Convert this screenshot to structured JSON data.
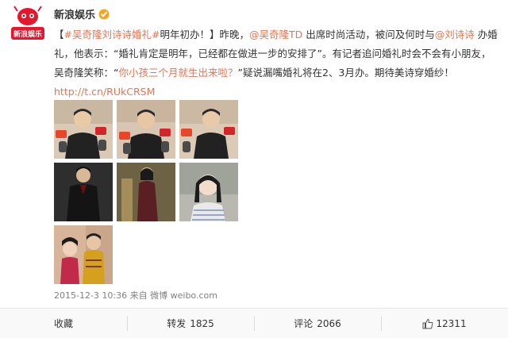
{
  "user": {
    "name": "新浪娱乐",
    "avatar_icon": "sina-entertainment-logo-icon",
    "avatar_text": "新浪娱乐",
    "verified": true
  },
  "post": {
    "bracket_open": "【",
    "topic": "#吴奇隆刘诗诗婚礼#",
    "headline": "明年初办！】",
    "text_1": "昨晚，",
    "mention_1": "@吴奇隆TD",
    "text_2": " 出席时尚活动，被问及何时与",
    "mention_2": "@刘诗诗",
    "text_3": " 办婚礼，他表示：“婚礼肯定是明年，已经都在做进一步的安排了”。有记者追问婚礼时会不会有小朋友，吴奇隆笑称：“",
    "quote": "你小孩三个月就生出来啦？",
    "text_4": "”疑说漏嘴婚礼将在2、3月办。期待美诗穿婚纱！",
    "short_link": "http://t.cn/RUkCRSM"
  },
  "images": [
    {
      "name": "photo-1",
      "desc": "Wu Qilong at press event"
    },
    {
      "name": "photo-2",
      "desc": "Wu Qilong at press event"
    },
    {
      "name": "photo-3",
      "desc": "Wu Qilong at press event"
    },
    {
      "name": "photo-4",
      "desc": "Wu Qilong in suit"
    },
    {
      "name": "photo-5",
      "desc": "Liu Shishi in dress"
    },
    {
      "name": "photo-6",
      "desc": "Liu Shishi portrait"
    },
    {
      "name": "photo-7",
      "desc": "Drama still"
    }
  ],
  "meta": {
    "timestamp": "2015-12-3 10:36",
    "from_label": "来自",
    "source": "微博 weibo.com"
  },
  "actions": {
    "favorite_label": "收藏",
    "repost_label": "转发",
    "repost_count": "1825",
    "comment_label": "评论",
    "comment_count": "2066",
    "like_count": "12311",
    "like_icon": "thumbs-up-icon"
  },
  "colors": {
    "link": "#eb7350",
    "mention": "#2a7bd1",
    "meta": "#808080",
    "brand": "#e6162d",
    "verify": "#f5a623"
  }
}
